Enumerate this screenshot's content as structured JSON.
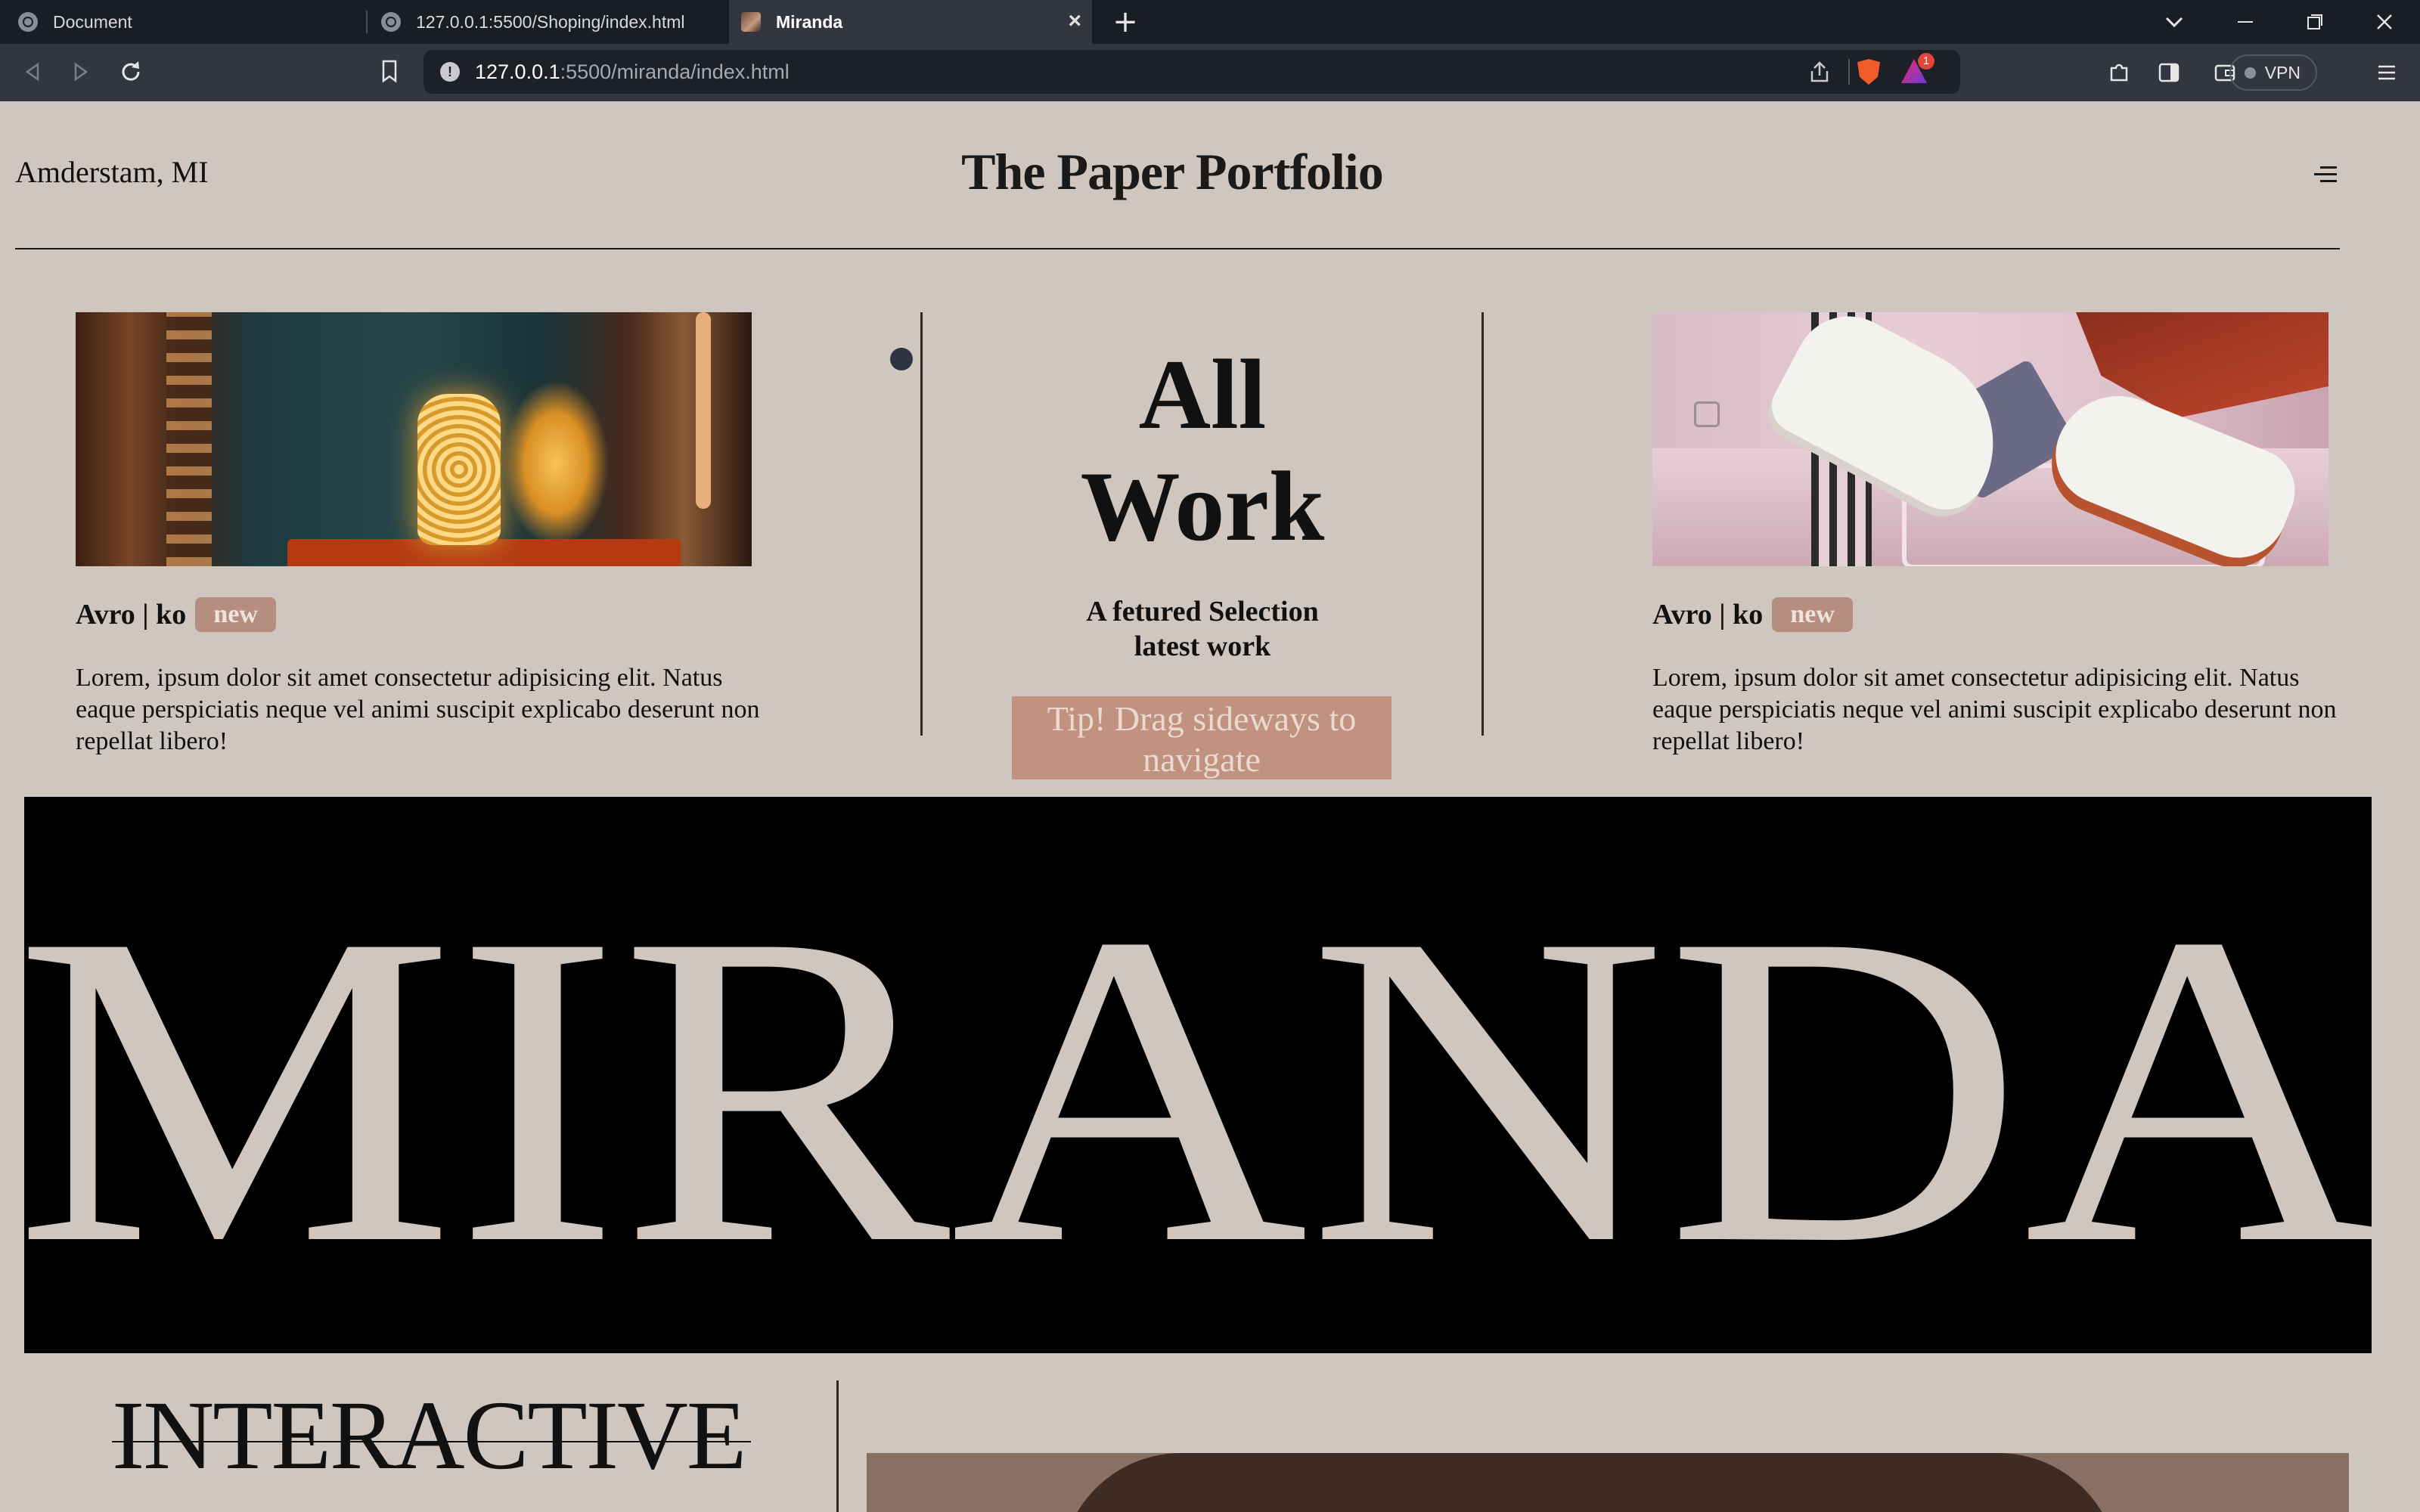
{
  "browser": {
    "tabs": [
      {
        "title": "Document",
        "active": false
      },
      {
        "title": "127.0.0.1:5500/Shoping/index.html",
        "active": false
      },
      {
        "title": "Miranda",
        "active": true
      }
    ],
    "new_tab_symbol": "+",
    "close_symbol": "×",
    "address": {
      "host": "127.0.0.1",
      "rest": ":5500/miranda/index.html"
    },
    "rewards_count": "1",
    "vpn_label": "VPN",
    "icons": [
      "back-icon",
      "forward-icon",
      "reload-icon",
      "bookmark-icon",
      "info-icon",
      "share-icon",
      "brave-shields-icon",
      "rewards-icon",
      "extensions-icon",
      "sidebar-icon",
      "wallet-icon",
      "menu-icon",
      "minimize-icon",
      "maximize-icon",
      "close-icon",
      "tab-list-icon"
    ]
  },
  "header": {
    "location": "Amderstam, MI",
    "logo": "The Paper Portfolio"
  },
  "cards": [
    {
      "title": "Avro | ko",
      "badge": "new",
      "text": "Lorem, ipsum dolor sit amet consectetur adipisicing elit. Natus eaque perspiciatis neque vel animi suscipit explicabo deserunt non repellat libero!"
    },
    {
      "title": "Avro | ko",
      "badge": "new",
      "text": "Lorem, ipsum dolor sit amet consectetur adipisicing elit. Natus eaque perspiciatis neque vel animi suscipit explicabo deserunt non repellat libero!"
    }
  ],
  "center": {
    "heading_line1": "All",
    "heading_line2": "Work",
    "sub_line1": "A fetured Selection",
    "sub_line2": "latest work",
    "tip_line1": "Tip! Drag sideways to",
    "tip_line2": "navigate"
  },
  "banner": {
    "text": "MIRANDA"
  },
  "bottom": {
    "heading": "INTERACTIVE"
  },
  "colors": {
    "page_bg": "#cec6bf",
    "badge_bg": "#b58e7f",
    "tip_bg": "#c19280",
    "banner_bg": "#000000",
    "banner_text": "#cec6bf"
  }
}
